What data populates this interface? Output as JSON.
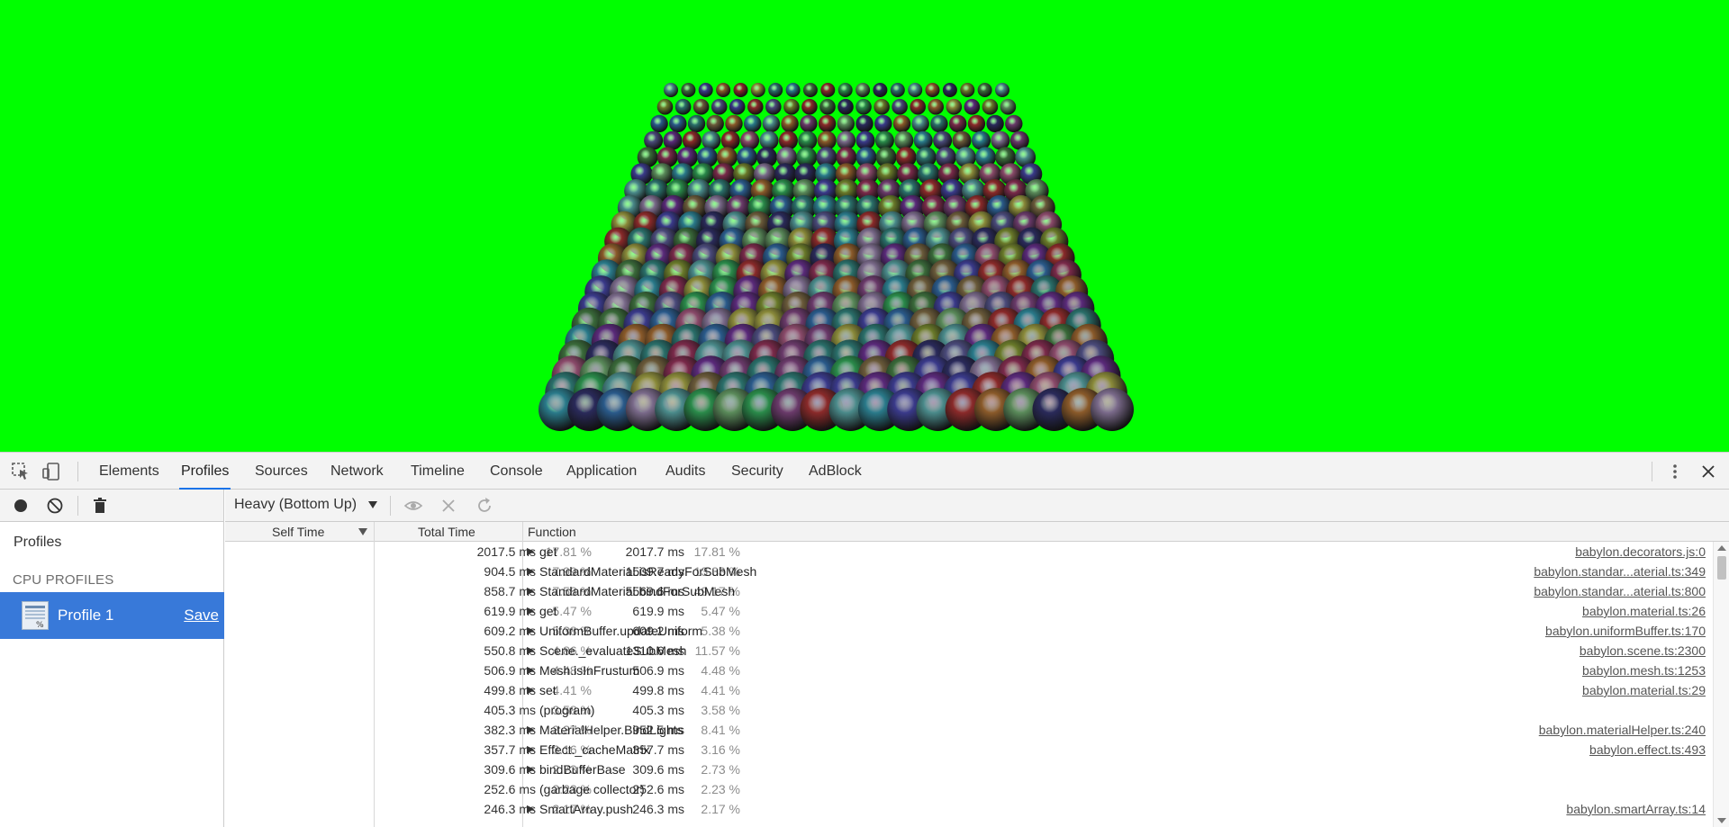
{
  "tabs": [
    {
      "label": "Elements"
    },
    {
      "label": "Profiles"
    },
    {
      "label": "Sources"
    },
    {
      "label": "Network"
    },
    {
      "label": "Timeline"
    },
    {
      "label": "Console"
    },
    {
      "label": "Application"
    },
    {
      "label": "Audits"
    },
    {
      "label": "Security"
    },
    {
      "label": "AdBlock"
    }
  ],
  "active_tab": "Profiles",
  "sidebar": {
    "heading": "Profiles",
    "section": "CPU PROFILES",
    "profile_name": "Profile 1",
    "save_label": "Save"
  },
  "toolbar": {
    "view_mode": "Heavy (Bottom Up)"
  },
  "grid": {
    "headers": {
      "self": "Self Time",
      "total": "Total Time",
      "function": "Function"
    },
    "rows": [
      {
        "self_ms": "2017.5 ms",
        "self_pct": "17.81 %",
        "total_ms": "2017.7 ms",
        "total_pct": "17.81 %",
        "expandable": true,
        "fn": "get",
        "url": "babylon.decorators.js:0"
      },
      {
        "self_ms": "904.5 ms",
        "self_pct": "7.99 %",
        "total_ms": "1509.7 ms",
        "total_pct": "13.33 %",
        "expandable": true,
        "fn": "StandardMaterial.isReadyForSubMesh",
        "url": "babylon.standar...aterial.ts:349"
      },
      {
        "self_ms": "858.7 ms",
        "self_pct": "7.58 %",
        "total_ms": "5569.6 ms",
        "total_pct": "49.17 %",
        "expandable": true,
        "fn": "StandardMaterial.bindForSubMesh",
        "url": "babylon.standar...aterial.ts:800"
      },
      {
        "self_ms": "619.9 ms",
        "self_pct": "5.47 %",
        "total_ms": "619.9 ms",
        "total_pct": "5.47 %",
        "expandable": true,
        "fn": "get",
        "url": "babylon.material.ts:26"
      },
      {
        "self_ms": "609.2 ms",
        "self_pct": "5.38 %",
        "total_ms": "609.2 ms",
        "total_pct": "5.38 %",
        "expandable": true,
        "fn": "UniformBuffer.updateUniform",
        "url": "babylon.uniformBuffer.ts:170"
      },
      {
        "self_ms": "550.8 ms",
        "self_pct": "4.86 %",
        "total_ms": "1310.6 ms",
        "total_pct": "11.57 %",
        "expandable": true,
        "fn": "Scene._evaluateSubMesh",
        "url": "babylon.scene.ts:2300"
      },
      {
        "self_ms": "506.9 ms",
        "self_pct": "4.48 %",
        "total_ms": "506.9 ms",
        "total_pct": "4.48 %",
        "expandable": true,
        "fn": "Mesh.isInFrustum",
        "url": "babylon.mesh.ts:1253"
      },
      {
        "self_ms": "499.8 ms",
        "self_pct": "4.41 %",
        "total_ms": "499.8 ms",
        "total_pct": "4.41 %",
        "expandable": true,
        "fn": "set",
        "url": "babylon.material.ts:29"
      },
      {
        "self_ms": "405.3 ms",
        "self_pct": "3.58 %",
        "total_ms": "405.3 ms",
        "total_pct": "3.58 %",
        "expandable": false,
        "fn": "(program)",
        "url": ""
      },
      {
        "self_ms": "382.3 ms",
        "self_pct": "3.37 %",
        "total_ms": "952.5 ms",
        "total_pct": "8.41 %",
        "expandable": true,
        "fn": "MaterialHelper.BindLights",
        "url": "babylon.materialHelper.ts:240"
      },
      {
        "self_ms": "357.7 ms",
        "self_pct": "3.16 %",
        "total_ms": "357.7 ms",
        "total_pct": "3.16 %",
        "expandable": true,
        "fn": "Effect._cacheMatrix",
        "url": "babylon.effect.ts:493"
      },
      {
        "self_ms": "309.6 ms",
        "self_pct": "2.73 %",
        "total_ms": "309.6 ms",
        "total_pct": "2.73 %",
        "expandable": true,
        "fn": "bindBufferBase",
        "url": ""
      },
      {
        "self_ms": "252.6 ms",
        "self_pct": "2.23 %",
        "total_ms": "252.6 ms",
        "total_pct": "2.23 %",
        "expandable": false,
        "fn": "(garbage collector)",
        "url": ""
      },
      {
        "self_ms": "246.3 ms",
        "self_pct": "2.17 %",
        "total_ms": "246.3 ms",
        "total_pct": "2.17 %",
        "expandable": true,
        "fn": "SmartArray.push",
        "url": "babylon.smartArray.ts:14"
      }
    ]
  },
  "icons": {
    "inspect": "inspect-element-icon",
    "device": "device-toggle-icon",
    "more": "more-vert-icon",
    "close": "close-icon",
    "record": "record-icon",
    "clear": "clear-icon",
    "trash": "trash-icon",
    "eye": "focus-icon",
    "exclude": "exclude-icon",
    "restore": "restore-icon",
    "profile": "profile-icon"
  },
  "colors": {
    "viewport_bg": "#00ff00",
    "selection": "#3879d9",
    "tab_indicator": "#1a73e8"
  }
}
